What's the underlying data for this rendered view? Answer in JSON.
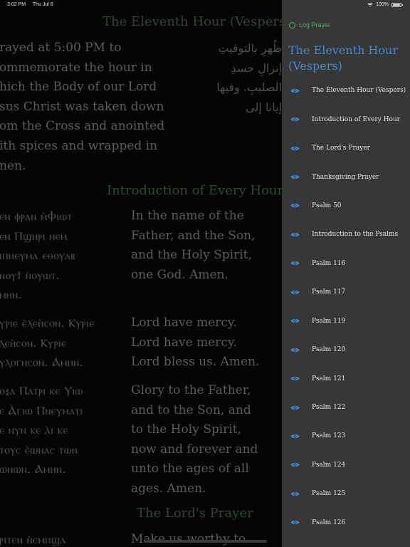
{
  "status_bar": {
    "time": "3:02 PM",
    "date": "Thu Jul 8",
    "battery": "100%"
  },
  "content": {
    "section1_title": "The Eleventh Hour (Vespers)",
    "section1_english": [
      "rayed at 5:00 PM to",
      "ommemorate the hour in",
      "hich the Body of our Lord",
      "sus Christ was taken down",
      "om the Cross and anointed",
      "ith spices and wrapped in",
      "nen."
    ],
    "section1_arabic": [
      "ظُهرِ بالتوقيتِ",
      "إنزالِ جسدِ",
      "الصليبِ. وفيها",
      "إيانا إلى"
    ],
    "section2_title": "Introduction of Every Hour",
    "block1_coptic": [
      "ⲉⲛ ⲫⲣⲁⲛ ⲙ̀Ⲫⲓⲱⲧ",
      "ⲉⲛ Ⲡϣⲏⲣⲓ ⲛⲉⲙ",
      "ⲓⲡⲛⲉⲩⲙⲁ ⲉⲑⲟⲩⲁⲃ",
      "ⲛⲟⲩϯ ⲛ̀ⲟⲩⲱⲧ.",
      "ⲙⲏⲛ."
    ],
    "block1_english": [
      "In the name of the",
      "Father, and the Son,",
      "and the Holy Spirit,",
      "one God. Amen."
    ],
    "block2_coptic": [
      "ⲩⲣⲓⲉ ⲉ̀ⲗⲉⲏ̀ⲥⲟⲛ. Ⲕⲩⲣⲓⲉ",
      "ⲗⲉⲏ̀ⲥⲟⲛ. Ⲕⲩⲣⲓⲉ",
      "ⲩⲗⲟⲅⲏⲥⲟⲛ. Ⲁⲙⲏⲛ."
    ],
    "block2_english": [
      "Lord have mercy.",
      "Lord have mercy.",
      "Lord bless us. Amen."
    ],
    "block3_coptic": [
      "ⲟⲝⲁ Ⲡⲁⲧⲣⲓ ⲕⲉ Ⲩⲓⲱ",
      "ⲉ Ⲁ̀ⲅⲓⲱ Ⲡⲛⲉⲩⲙⲁⲧⲓ",
      "ⲉ ⲛⲩⲛ ⲕⲉ ⲁ̀ⲓ ⲕⲉ",
      "ⲧⲟⲩⲥ ⲉ̀ⲱⲛⲁⲥ ⲧⲱⲛ",
      "ⲱⲛⲱⲛ. Ⲁⲙⲏⲛ."
    ],
    "block3_english": [
      "Glory to the Father,",
      "and to the Son, and",
      "to the Holy Spirit,",
      "now and forever and",
      "unto the ages of all",
      "ages. Amen."
    ],
    "section3_title": "The Lord's Prayer",
    "block4_coptic": [
      "ⲣⲓⲧⲉⲛ ⲛ̀ⲉⲙⲡϣⲁ"
    ],
    "block4_english": [
      "Make us worthy to"
    ]
  },
  "sidebar": {
    "log_prayer": "Log Prayer",
    "title": "The Eleventh Hour (Vespers)",
    "items": [
      {
        "label": "The Eleventh Hour (Vespers)"
      },
      {
        "label": "Introduction of Every Hour"
      },
      {
        "label": "The Lord's Prayer"
      },
      {
        "label": "Thanksgiving Prayer"
      },
      {
        "label": "Psalm 50"
      },
      {
        "label": "Introduction to the Psalms"
      },
      {
        "label": "Psalm 116"
      },
      {
        "label": "Psalm 117"
      },
      {
        "label": "Psalm 119"
      },
      {
        "label": "Psalm 120"
      },
      {
        "label": "Psalm 121"
      },
      {
        "label": "Psalm 122"
      },
      {
        "label": "Psalm 123"
      },
      {
        "label": "Psalm 124"
      },
      {
        "label": "Psalm 125"
      },
      {
        "label": "Psalm 126"
      }
    ]
  },
  "colors": {
    "sidebar_bg": "#373737",
    "accent_blue": "#3d8bd8",
    "accent_green": "#3bb86b",
    "section_title": "#2c4a2c"
  },
  "icons": {
    "nav_item": "eye-icon",
    "log_prayer": "circle-icon"
  }
}
